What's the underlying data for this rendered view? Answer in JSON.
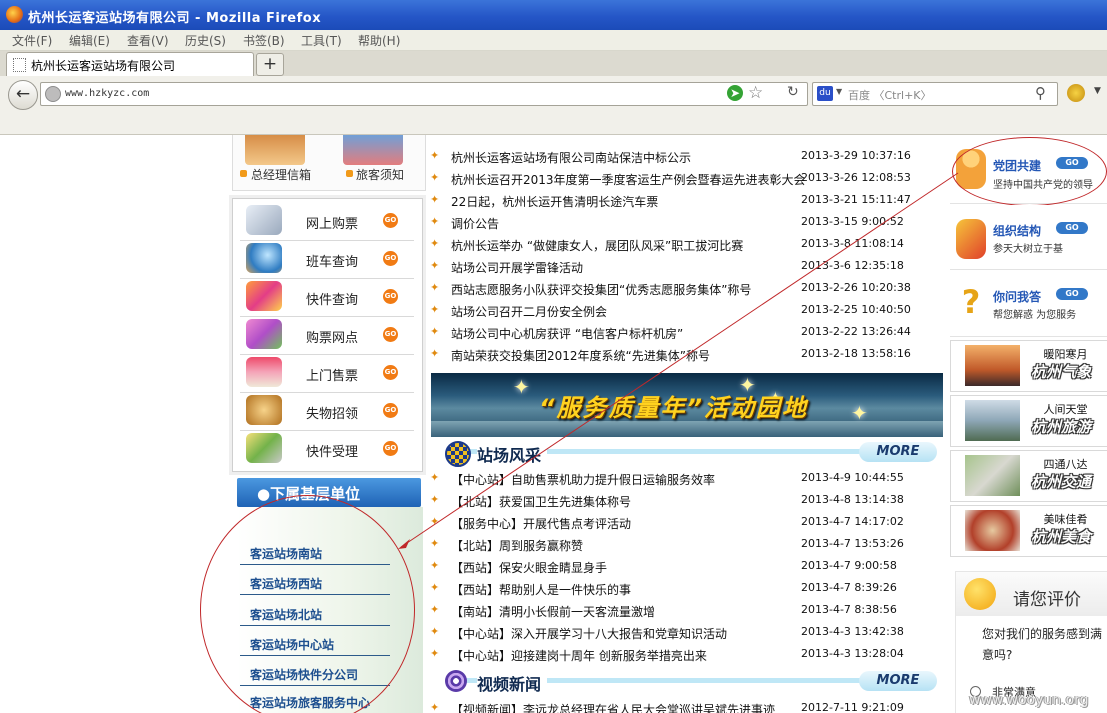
{
  "window": {
    "title": "杭州长运客运站场有限公司 - Mozilla Firefox"
  },
  "menu": [
    "文件(F)",
    "编辑(E)",
    "查看(V)",
    "历史(S)",
    "书签(B)",
    "工具(T)",
    "帮助(H)"
  ],
  "tab": {
    "label": "杭州长运客运站场有限公司",
    "new_tab": "+"
  },
  "nav": {
    "url": "www.hzkyzc.com",
    "search_placeholder": "百度 〈Ctrl+K〉"
  },
  "top_icons": [
    {
      "label": "总经理信箱"
    },
    {
      "label": "旅客须知"
    }
  ],
  "services": [
    {
      "label": "网上购票",
      "go": "GO"
    },
    {
      "label": "班车查询",
      "go": "GO"
    },
    {
      "label": "快件查询",
      "go": "GO"
    },
    {
      "label": "购票网点",
      "go": "GO"
    },
    {
      "label": "上门售票",
      "go": "GO"
    },
    {
      "label": "失物招领",
      "go": "GO"
    },
    {
      "label": "快件受理",
      "go": "GO"
    }
  ],
  "sub_units": {
    "title": "●下属基层单位",
    "items": [
      "客运站场南站",
      "客运站场西站",
      "客运站场北站",
      "客运站场中心站",
      "客运站场快件分公司",
      "客运站场旅客服务中心"
    ]
  },
  "news_top": [
    {
      "title": "杭州长运客运站场有限公司南站保洁中标公示",
      "date": "2013-3-29 10:37:16"
    },
    {
      "title": "杭州长运召开2013年度第一季度客运生产例会暨春运先进表彰大会",
      "date": "2013-3-26 12:08:53"
    },
    {
      "title": "22日起，杭州长运开售清明长途汽车票",
      "date": "2013-3-21 15:11:47"
    },
    {
      "title": "调价公告",
      "date": "2013-3-15 9:00:52"
    },
    {
      "title": "杭州长运举办 “做健康女人，展团队风采”职工拔河比赛",
      "date": "2013-3-8 11:08:14"
    },
    {
      "title": "站场公司开展学雷锋活动",
      "date": "2013-3-6 12:35:18"
    },
    {
      "title": "西站志愿服务小队获评交投集团“优秀志愿服务集体”称号",
      "date": "2013-2-26 10:20:38"
    },
    {
      "title": "站场公司召开二月份安全例会",
      "date": "2013-2-25 10:40:50"
    },
    {
      "title": "站场公司中心机房获评 “电信客户标杆机房”",
      "date": "2013-2-22 13:26:44"
    },
    {
      "title": "南站荣获交投集团2012年度系统“先进集体”称号",
      "date": "2013-2-18 13:58:16"
    }
  ],
  "banner": {
    "text": "“服务质量年”活动园地"
  },
  "section_station": {
    "title": "站场风采",
    "more": "MORE"
  },
  "news_station": [
    {
      "title": "【中心站】自助售票机助力提升假日运输服务效率",
      "date": "2013-4-9 10:44:55"
    },
    {
      "title": "【北站】获爱国卫生先进集体称号",
      "date": "2013-4-8 13:14:38"
    },
    {
      "title": "【服务中心】开展代售点考评活动",
      "date": "2013-4-7 14:17:02"
    },
    {
      "title": "【北站】周到服务赢称赞",
      "date": "2013-4-7 13:53:26"
    },
    {
      "title": "【西站】保安火眼金睛显身手",
      "date": "2013-4-7 9:00:58"
    },
    {
      "title": "【西站】帮助别人是一件快乐的事",
      "date": "2013-4-7 8:39:26"
    },
    {
      "title": "【南站】清明小长假前一天客流量激增",
      "date": "2013-4-7 8:38:56"
    },
    {
      "title": "【中心站】深入开展学习十八大报告和党章知识活动",
      "date": "2013-4-3 13:42:38"
    },
    {
      "title": "【中心站】迎接建岗十周年 创新服务举措亮出来",
      "date": "2013-4-3 13:28:04"
    }
  ],
  "section_video": {
    "title": "视频新闻",
    "more": "MORE"
  },
  "news_video": [
    {
      "title": "【视频新闻】李远龙总经理在省人民大会堂巡讲吴斌先进事迹",
      "date": "2012-7-11 9:21:09"
    }
  ],
  "right_blocks": [
    {
      "title": "党团共建",
      "sub": "坚持中国共产党的领导",
      "go": "GO"
    },
    {
      "title": "组织结构",
      "sub": "参天大树立于基",
      "go": "GO"
    },
    {
      "title": "你问我答",
      "sub": "帮您解惑 为您服务",
      "go": "GO"
    }
  ],
  "right_tiles": [
    {
      "caption": "暖阳寒月",
      "big": "杭州气象"
    },
    {
      "caption": "人间天堂",
      "big": "杭州旅游"
    },
    {
      "caption": "四通八达",
      "big": "杭州交通"
    },
    {
      "caption": "美味佳肴",
      "big": "杭州美食"
    }
  ],
  "rating": {
    "title": "请您评价",
    "question": "您对我们的服务感到满意吗?",
    "option": "非常满意"
  },
  "watermark": "www.wooyun.org"
}
